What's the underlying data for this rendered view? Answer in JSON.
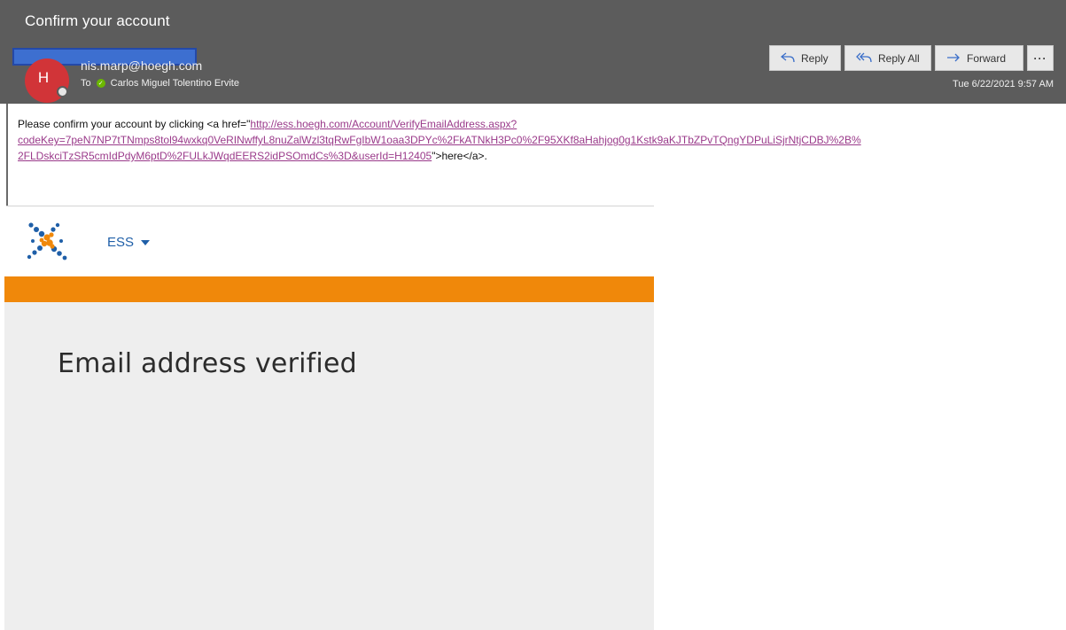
{
  "window": {
    "subject": "Confirm your account"
  },
  "sender": {
    "avatar_initial": "H",
    "email": "nis.marp@hoegh.com",
    "to_label": "To",
    "recipient": "Carlos Miguel Tolentino Ervite",
    "timestamp": "Tue 6/22/2021 9:57 AM"
  },
  "toolbar": {
    "reply": "Reply",
    "reply_all": "Reply All",
    "forward": "Forward",
    "more": "···"
  },
  "body": {
    "text_before": "Please confirm your account by clicking <a href=\"",
    "link_line1": "http://ess.hoegh.com/Account/VerifyEmailAddress.aspx?",
    "link_line2": "codeKey=7peN7NP7tTNmps8tol94wxkq0VeRINwffyL8nuZalWzl3tqRwFgIbW1oaa3DPYc%2FkATNkH3Pc0%2F95XKf8aHahjog0g1Kstk9aKJTbZPvTQngYDPuLiSjrNtjCDBJ%2B%",
    "link_line3": "2FLDskciTzSR5cmIdPdyM6ptD%2FULkJWqdEERS2idPSOmdCs%3D&userId=H12405",
    "text_after": "\">here</a>."
  },
  "ess_page": {
    "menu_label": "ESS",
    "heading": "Email address verified"
  },
  "colors": {
    "header_bg": "#5c5c5c",
    "avatar_bg": "#d13438",
    "accent_orange": "#f0880a",
    "link": "#9a3a8a",
    "ess_blue": "#1f5fa8"
  },
  "icons": {
    "reply": "reply-arrow-icon",
    "reply_all": "reply-all-arrow-icon",
    "forward": "forward-arrow-icon",
    "more": "more-ellipsis-icon",
    "presence": "presence-status-icon",
    "verified": "green-check-icon",
    "logo": "hoegh-star-logo-icon",
    "caret": "caret-down-icon"
  }
}
